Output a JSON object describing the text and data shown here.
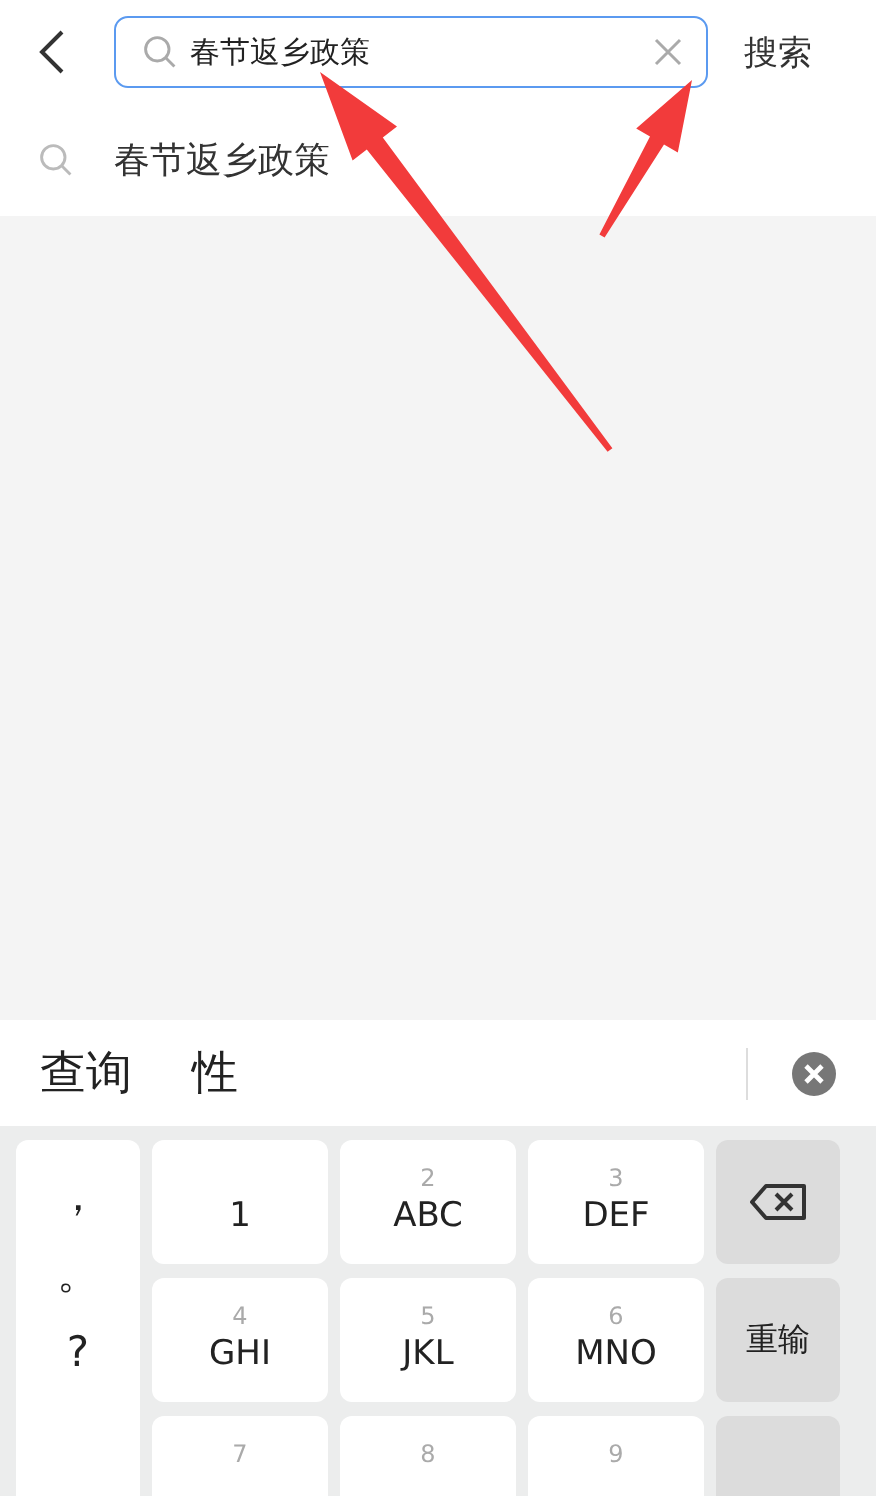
{
  "top_bar": {
    "search": {
      "value": "春节返乡政策"
    },
    "search_button": "搜索"
  },
  "suggestions": [
    {
      "text": "春节返乡政策"
    }
  ],
  "candidates": [
    "查询",
    "性"
  ],
  "keyboard": {
    "symbols": [
      "，",
      "。",
      "?"
    ],
    "rows": [
      [
        {
          "letters": "1"
        },
        {
          "digit": "2",
          "letters": "ABC"
        },
        {
          "digit": "3",
          "letters": "DEF"
        }
      ],
      [
        {
          "digit": "4",
          "letters": "GHI"
        },
        {
          "digit": "5",
          "letters": "JKL"
        },
        {
          "digit": "6",
          "letters": "MNO"
        }
      ],
      [
        {
          "digit": "7"
        },
        {
          "digit": "8"
        },
        {
          "digit": "9"
        }
      ]
    ],
    "side_keys": [
      {
        "kind": "delete"
      },
      {
        "kind": "text",
        "label": "重输"
      },
      {
        "kind": "blank"
      }
    ]
  },
  "annotations": [
    {
      "kind": "arrow"
    },
    {
      "kind": "arrow"
    }
  ]
}
